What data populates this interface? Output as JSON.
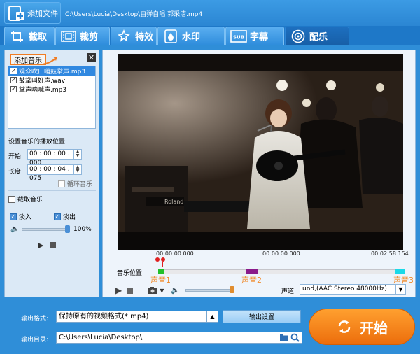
{
  "topbar": {
    "add_file_label": "添加文件",
    "file_path": "C:\\Users\\Lucia\\Desktop\\自弹自唱 郭采洁.mp4"
  },
  "tabs": [
    {
      "label": "截取",
      "icon": "crop-icon"
    },
    {
      "label": "裁剪",
      "icon": "film-crop-icon"
    },
    {
      "label": "特效",
      "icon": "effects-icon"
    },
    {
      "label": "水印",
      "icon": "watermark-icon"
    },
    {
      "label": "字幕",
      "icon": "subtitle-icon"
    },
    {
      "label": "配乐",
      "icon": "music-icon",
      "active": true
    }
  ],
  "music_panel": {
    "add_music_label": "添加音乐",
    "files": [
      {
        "name": "观众吹口哨鼓掌声.mp3",
        "checked": true,
        "selected": true
      },
      {
        "name": "鼓掌叫好声.wav",
        "checked": true,
        "selected": false
      },
      {
        "name": "掌声呐喊声.mp3",
        "checked": true,
        "selected": false
      }
    ],
    "position_title": "设置音乐的播放位置",
    "start_label": "开始:",
    "start_value": "00 : 00 : 00 . 000",
    "length_label": "长度:",
    "length_value": "00 : 00 : 04 . 075",
    "loop_label": "循环音乐",
    "cut_label": "截取音乐",
    "fade_in_label": "淡入",
    "fade_out_label": "淡出",
    "volume_value": "100%"
  },
  "preview": {
    "time_start": "00:00:00.000",
    "time_current": "00:00:00.000",
    "time_end": "00:02:58.154",
    "music_position_label": "音乐位置:",
    "sound_markers": [
      "声音1",
      "声音2",
      "声音3"
    ],
    "channel_label": "声道:",
    "channel_value": "und,(AAC Stereo 48000Hz)"
  },
  "output": {
    "format_label": "输出格式:",
    "format_value": "保持原有的视频格式(*.mp4)",
    "settings_label": "输出设置",
    "dir_label": "输出目录:",
    "dir_value": "C:\\Users\\Lucia\\Desktop\\",
    "start_label": "开始"
  },
  "colors": {
    "accent": "#2f8ed8",
    "start_button": "#f07a1a",
    "sound_marker_text": "#f08a2a",
    "segment_1": "#22c02a",
    "segment_2": "#8a1a8a",
    "segment_3": "#19d9e8"
  }
}
